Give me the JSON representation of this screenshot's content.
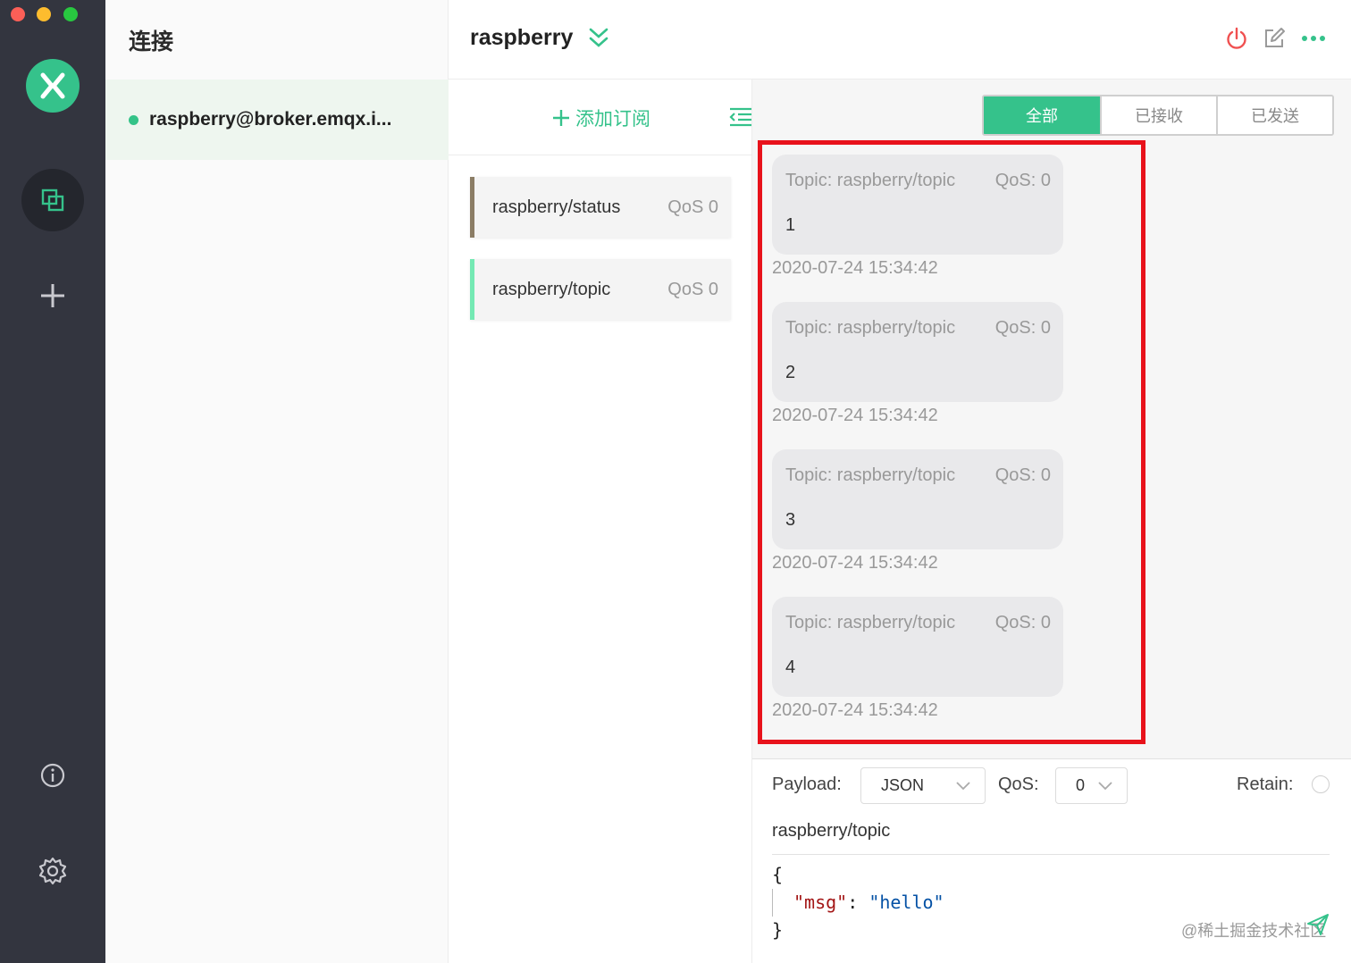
{
  "sidebar": {
    "icons": [
      "connections-icon",
      "add-icon",
      "info-icon",
      "settings-icon"
    ]
  },
  "connections": {
    "title": "连接",
    "items": [
      {
        "name": "raspberry@broker.emqx.i...",
        "status_color": "#34c388"
      }
    ]
  },
  "header": {
    "title": "raspberry"
  },
  "subscriptions": {
    "add_label": "添加订阅",
    "items": [
      {
        "topic": "raspberry/status",
        "qos": "QoS 0",
        "color": "#8b7d65"
      },
      {
        "topic": "raspberry/topic",
        "qos": "QoS 0",
        "color": "#74e9b3"
      }
    ]
  },
  "messages": {
    "filters": [
      "全部",
      "已接收",
      "已发送"
    ],
    "active_filter": "全部",
    "list": [
      {
        "topic": "Topic: raspberry/topic",
        "qos": "QoS: 0",
        "payload": "1",
        "time": "2020-07-24 15:34:42"
      },
      {
        "topic": "Topic: raspberry/topic",
        "qos": "QoS: 0",
        "payload": "2",
        "time": "2020-07-24 15:34:42"
      },
      {
        "topic": "Topic: raspberry/topic",
        "qos": "QoS: 0",
        "payload": "3",
        "time": "2020-07-24 15:34:42"
      },
      {
        "topic": "Topic: raspberry/topic",
        "qos": "QoS: 0",
        "payload": "4",
        "time": "2020-07-24 15:34:42"
      }
    ]
  },
  "publish": {
    "payload_label": "Payload:",
    "payload_format": "JSON",
    "qos_label": "QoS:",
    "qos_value": "0",
    "retain_label": "Retain:",
    "topic": "raspberry/topic",
    "code": {
      "open": "{",
      "key": "\"msg\"",
      "colon": ": ",
      "value": "\"hello\"",
      "close": "}"
    }
  },
  "watermark": "@稀土掘金技术社区",
  "colors": {
    "accent": "#35c28b",
    "rail": "#33353f",
    "highlight": "#e8121b",
    "disconnect": "#f05050"
  }
}
